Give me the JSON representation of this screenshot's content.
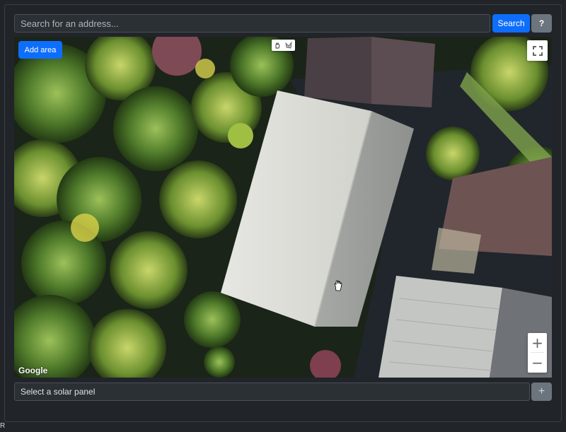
{
  "search": {
    "placeholder": "Search for an address...",
    "button_label": "Search",
    "help_label": "?"
  },
  "map": {
    "add_area_label": "Add area",
    "attribution": "Google",
    "zoom_in_label": "+",
    "zoom_out_label": "−",
    "icons": {
      "pan_tool": "hand-icon",
      "draw_tool": "polygon-icon",
      "fullscreen": "fullscreen-icon",
      "cursor": "hand-cursor-icon"
    }
  },
  "panel_select": {
    "label": "Select a solar panel",
    "add_label": "+"
  },
  "corner_text": "R",
  "colors": {
    "primary": "#0d6efd",
    "secondary": "#6c757d",
    "background": "#212529"
  }
}
